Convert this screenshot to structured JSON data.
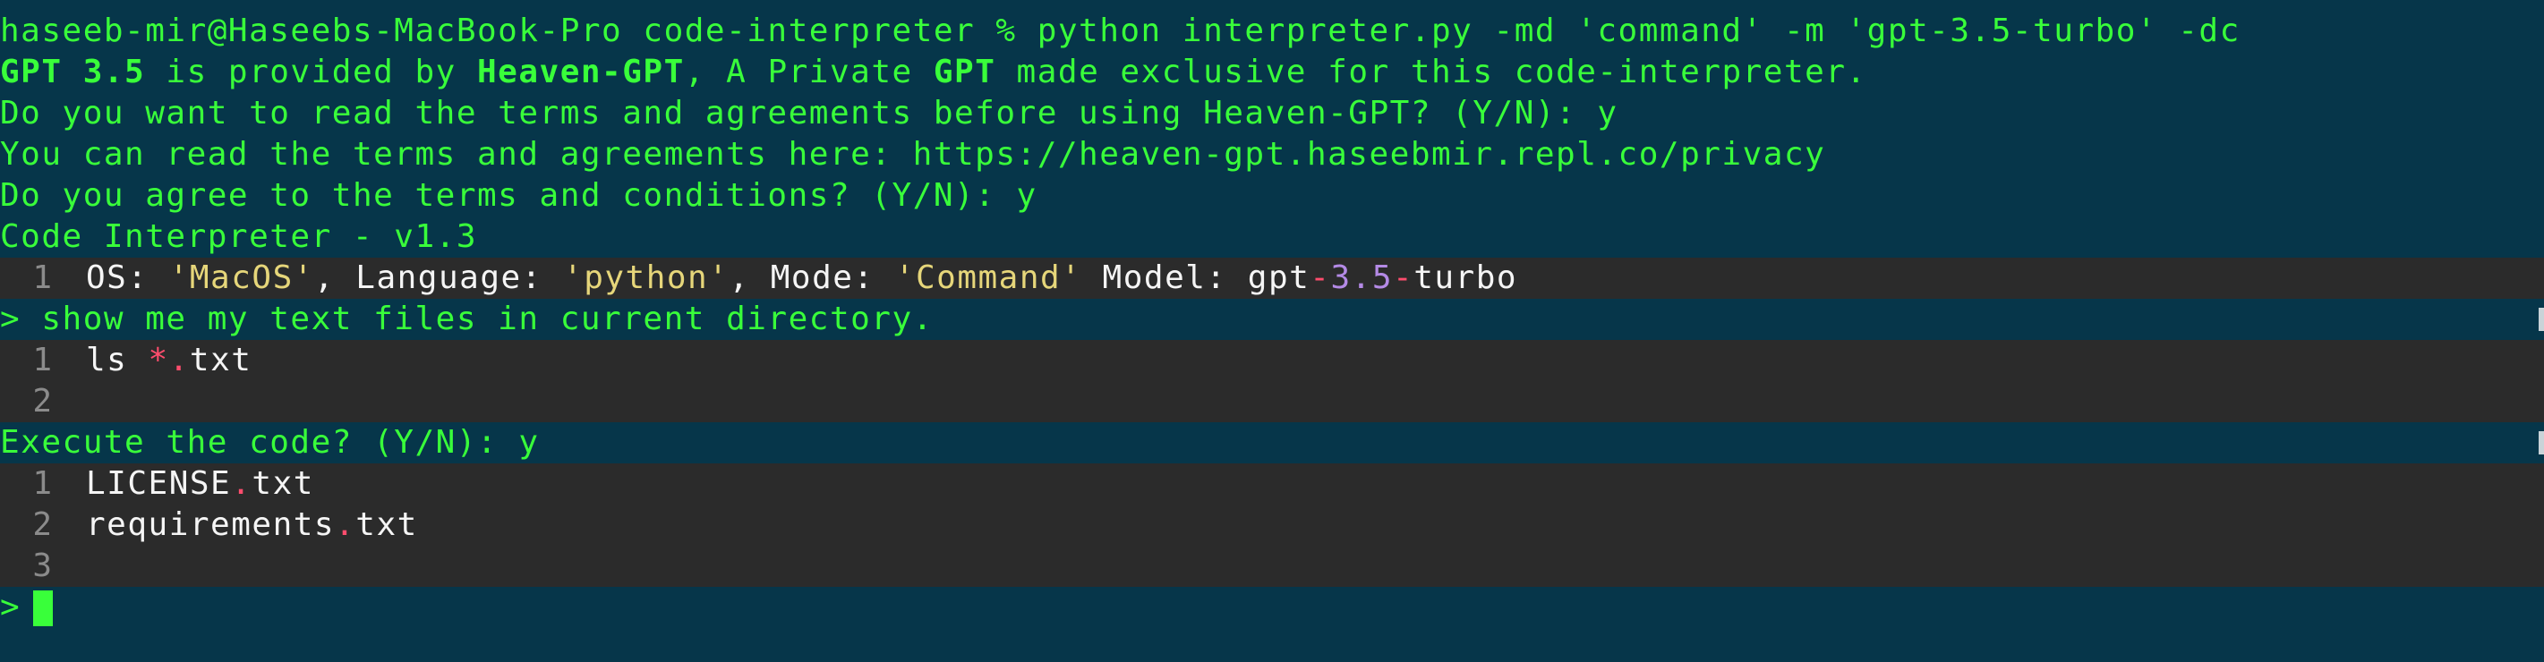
{
  "colors": {
    "background": "#06364a",
    "prompt_green": "#39ff3a",
    "code_block": "#2b2b2b",
    "string": "#e6d67a",
    "number": "#b48ae6",
    "operator": "#ff4d6d"
  },
  "terminal": {
    "command_line": "haseeb-mir@Haseebs-MacBook-Pro code-interpreter % python interpreter.py -md 'command' -m 'gpt-3.5-turbo' -dc",
    "provided": {
      "model": "GPT 3.5",
      "mid1": " is provided by ",
      "brand": "Heaven-GPT",
      "mid2": ", A Private ",
      "gpt": "GPT",
      "end": " made exclusive for this code-interpreter."
    },
    "terms_question": "Do you want to read the terms and agreements before using Heaven-GPT? (Y/N): y",
    "terms_link": "You can read the terms and agreements here: https://heaven-gpt.haseebmir.repl.co/privacy",
    "agree_question": "Do you agree to the terms and conditions? (Y/N): y",
    "version": "Code Interpreter - v1.3",
    "info_block": {
      "line_number": "1",
      "os_label": "OS: ",
      "os_value": "'MacOS'",
      "lang_label": ", Language: ",
      "lang_value": "'python'",
      "mode_label": ", Mode: ",
      "mode_value": "'Command'",
      "model_label": " Model: gpt",
      "model_dash1": "-",
      "model_num": "3.5",
      "model_dash2": "-",
      "model_end": "turbo"
    },
    "user_prompt": "> show me my text files in current directory.",
    "code_block": {
      "lines": [
        {
          "n": "1",
          "pre": "ls ",
          "op": "*",
          "dot": ".",
          "post": "txt"
        },
        {
          "n": "2"
        }
      ]
    },
    "execute_question": "Execute the code? (Y/N): y",
    "output_block": {
      "lines": [
        {
          "n": "1",
          "name": "LICENSE",
          "dot": ".",
          "ext": "txt"
        },
        {
          "n": "2",
          "name": "requirements",
          "dot": ".",
          "ext": "txt"
        },
        {
          "n": "3"
        }
      ]
    },
    "final_prompt": ">"
  }
}
